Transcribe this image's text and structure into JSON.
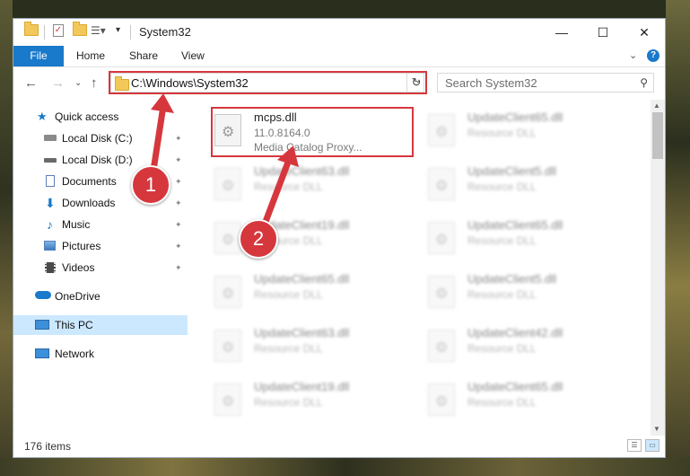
{
  "window": {
    "title": "System32",
    "minimize": "—",
    "maximize": "☐",
    "close": "✕"
  },
  "ribbon": {
    "tabs": [
      "File",
      "Home",
      "Share",
      "View"
    ],
    "expand": "⌄",
    "help": "?"
  },
  "address": {
    "path": "C:\\Windows\\System32",
    "refresh": "↻",
    "back": "←",
    "forward": "→",
    "recent": "⌄",
    "up": "↑"
  },
  "search": {
    "placeholder": "Search System32",
    "icon": "⚲"
  },
  "nav": {
    "quick_access": "Quick access",
    "items": [
      {
        "label": "Local Disk (C:)",
        "icon": "drive-icon",
        "pinned": true
      },
      {
        "label": "Local Disk (D:)",
        "icon": "drive-icon",
        "pinned": true
      },
      {
        "label": "Documents",
        "icon": "documents-icon",
        "pinned": true
      },
      {
        "label": "Downloads",
        "icon": "downloads-icon",
        "pinned": true
      },
      {
        "label": "Music",
        "icon": "music-icon",
        "pinned": true
      },
      {
        "label": "Pictures",
        "icon": "pictures-icon",
        "pinned": true
      },
      {
        "label": "Videos",
        "icon": "videos-icon",
        "pinned": true
      }
    ],
    "onedrive": "OneDrive",
    "this_pc": "This PC",
    "network": "Network",
    "pin_glyph": "📌"
  },
  "files": {
    "highlighted": {
      "name": "mcps.dll",
      "version": "11.0.8164.0",
      "description": "Media Catalog Proxy..."
    },
    "left_column": [
      {
        "name": "UpdateClient63.dll",
        "type": "Resource DLL"
      },
      {
        "name": "UpdateClient19.dll",
        "type": "Resource DLL"
      },
      {
        "name": "UpdateClient65.dll",
        "type": "Resource DLL"
      },
      {
        "name": "UpdateClient63.dll",
        "type": "Resource DLL"
      },
      {
        "name": "UpdateClient19.dll",
        "type": "Resource DLL"
      }
    ],
    "right_column": [
      {
        "name": "UpdateClient65.dll",
        "type": "Resource DLL"
      },
      {
        "name": "UpdateClient5.dll",
        "type": "Resource DLL"
      },
      {
        "name": "UpdateClient65.dll",
        "type": "Resource DLL"
      },
      {
        "name": "UpdateClient5.dll",
        "type": "Resource DLL"
      },
      {
        "name": "UpdateClient42.dll",
        "type": "Resource DLL"
      },
      {
        "name": "UpdateClient65.dll",
        "type": "Resource DLL"
      }
    ]
  },
  "status": {
    "item_count": "176 items"
  },
  "annotations": {
    "step1": "1",
    "step2": "2",
    "color": "#d6373d"
  }
}
